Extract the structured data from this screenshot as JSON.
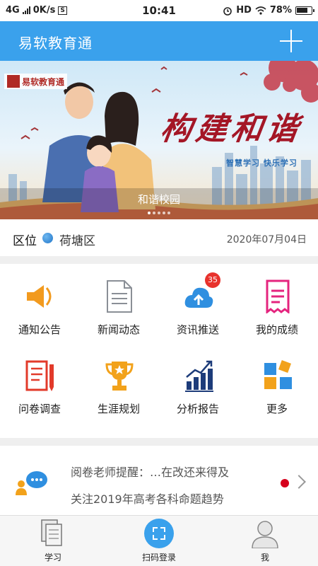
{
  "status_bar": {
    "network": "4G",
    "speed": "0K/s",
    "time": "10:41",
    "hd": "HD",
    "battery": "78%"
  },
  "header": {
    "title": "易软教育通",
    "add_icon": "plus-icon"
  },
  "banner": {
    "logo_text": "易软教育通",
    "slogan": "构建和谐",
    "subslogan": "智慧学习  快乐学习",
    "caption": "和谐校园",
    "slide_count": 5,
    "active_slide": 1
  },
  "district": {
    "label": "区位",
    "name": "荷塘区",
    "date": "2020年07月04日"
  },
  "grid": {
    "items": [
      {
        "label": "通知公告",
        "icon": "megaphone-icon"
      },
      {
        "label": "新闻动态",
        "icon": "news-icon"
      },
      {
        "label": "资讯推送",
        "icon": "cloud-upload-icon",
        "badge": "35"
      },
      {
        "label": "我的成绩",
        "icon": "grade-sheet-icon"
      },
      {
        "label": "问卷调查",
        "icon": "survey-icon"
      },
      {
        "label": "生涯规划",
        "icon": "trophy-icon"
      },
      {
        "label": "分析报告",
        "icon": "bar-chart-icon"
      },
      {
        "label": "更多",
        "icon": "more-blocks-icon"
      }
    ]
  },
  "notice": {
    "line1": "阅卷老师提醒：…在改还来得及",
    "line2": "关注2019年高考各科命题趋势"
  },
  "tabbar": {
    "tabs": [
      {
        "label": "学习",
        "icon": "book-icon"
      },
      {
        "label": "扫码登录",
        "icon": "scan-icon"
      },
      {
        "label": "我",
        "icon": "user-icon"
      }
    ]
  },
  "colors": {
    "primary": "#3aa1ec",
    "badge": "#e8322d",
    "accent_red": "#d6001c"
  }
}
